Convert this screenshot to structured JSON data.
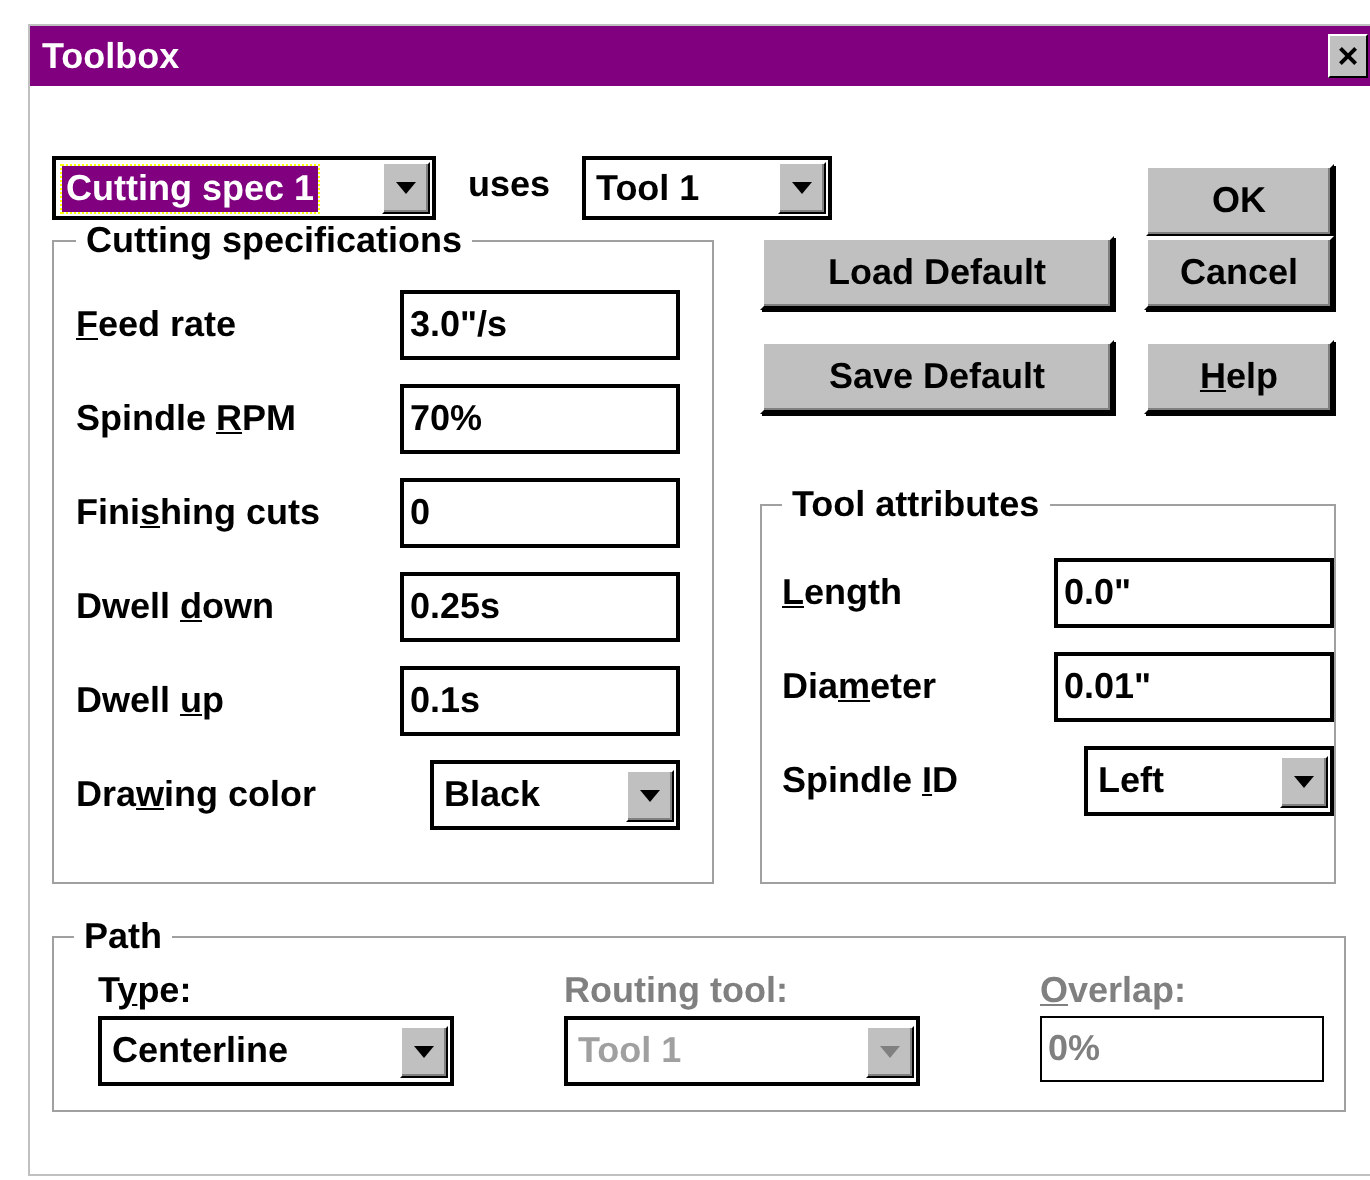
{
  "window": {
    "title": "Toolbox",
    "close": "×"
  },
  "spec_select": {
    "value": "Cutting spec 1",
    "focused": true
  },
  "uses_label": "uses",
  "tool_select": {
    "value": "Tool 1",
    "focused": false
  },
  "buttons": [
    {
      "label": {
        "pre": "OK"
      }
    },
    {
      "label": {
        "pre": "Load Default"
      }
    },
    {
      "label": {
        "pre": "Cancel"
      }
    },
    {
      "label": {
        "pre": "Save Default"
      }
    },
    {
      "label": {
        "key": "H",
        "post": "elp"
      }
    }
  ],
  "cutting_specifications": {
    "title": "Cutting specifications",
    "fields": [
      {
        "kind": "text",
        "label": {
          "key": "F",
          "post": "eed rate"
        },
        "value": "3.0\"/s"
      },
      {
        "kind": "text",
        "label": {
          "pre": "Spindle ",
          "key": "R",
          "post": "PM"
        },
        "value": "70%"
      },
      {
        "kind": "text",
        "label": {
          "pre": "Fini",
          "key": "s",
          "post": "hing cuts"
        },
        "value": "0"
      },
      {
        "kind": "text",
        "label": {
          "pre": "Dwell ",
          "key": "d",
          "post": "own"
        },
        "value": "0.25s"
      },
      {
        "kind": "text",
        "label": {
          "pre": "Dwell ",
          "key": "u",
          "post": "p"
        },
        "value": "0.1s"
      },
      {
        "kind": "select",
        "label": {
          "pre": "Dra",
          "key": "w",
          "post": "ing color"
        },
        "value": "Black"
      }
    ]
  },
  "tool_attributes": {
    "title": "Tool attributes",
    "fields": [
      {
        "kind": "text",
        "label": {
          "key": "L",
          "post": "ength"
        },
        "value": "0.0\""
      },
      {
        "kind": "text",
        "label": {
          "pre": "Dia",
          "key": "m",
          "post": "eter"
        },
        "value": "0.01\""
      },
      {
        "kind": "select",
        "label": {
          "pre": "Spindle ",
          "key": "I",
          "post": "D"
        },
        "value": "Left"
      }
    ]
  },
  "path": {
    "title": "Path",
    "fields": [
      {
        "kind": "select",
        "label": {
          "pre": "T",
          "key": "y",
          "post": "pe:"
        },
        "value": "Centerline",
        "disabled": false
      },
      {
        "kind": "select",
        "label": {
          "pre": "Routin",
          "key": "g",
          "post": " tool:"
        },
        "value": "Tool 1",
        "disabled": true
      },
      {
        "kind": "text",
        "label": {
          "key": "O",
          "post": "verlap:"
        },
        "value": "0%",
        "disabled": true
      }
    ]
  }
}
